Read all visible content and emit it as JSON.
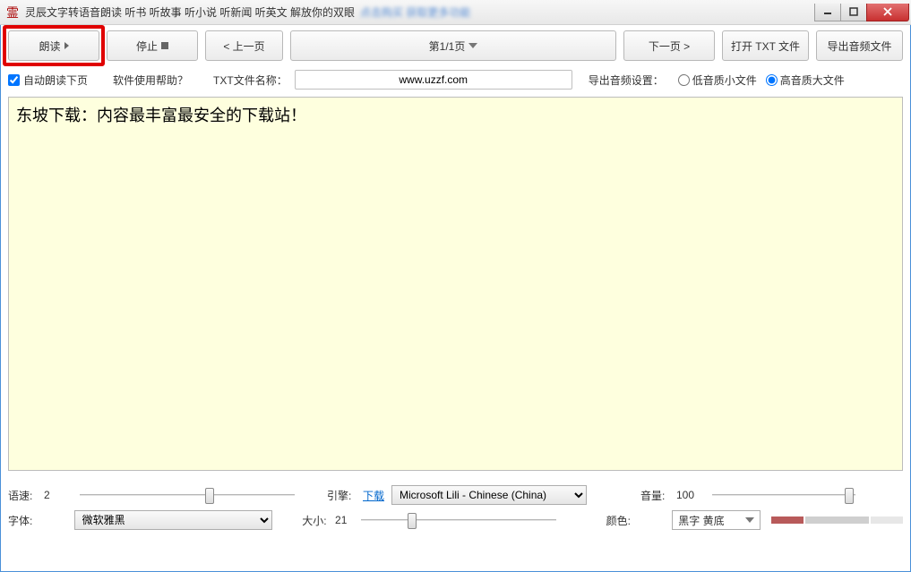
{
  "window": {
    "title": "灵辰文字转语音朗读   听书 听故事 听小说 听新闻 听英文 解放你的双眼",
    "blur_text": "点击购买  获取更多功能"
  },
  "toolbar": {
    "read": "朗读",
    "stop": "停止",
    "prev": "< 上一页",
    "page": "第1/1页",
    "next": "下一页 >",
    "open_txt": "打开 TXT 文件",
    "export_audio": "导出音频文件"
  },
  "row2": {
    "auto_read": "自动朗读下页",
    "help": "软件使用帮助？",
    "txt_name_label": "TXT文件名称：",
    "txt_name_value": "www.uzzf.com",
    "export_settings": "导出音频设置：",
    "low_quality": "低音质小文件",
    "high_quality": "高音质大文件"
  },
  "content": {
    "text": "东坡下载：内容最丰富最安全的下载站！"
  },
  "footer": {
    "speed_label": "语速:",
    "speed_value": "2",
    "engine_label": "引擎:",
    "download": "下载",
    "engine_value": "Microsoft Lili - Chinese (China)",
    "volume_label": "音量:",
    "volume_value": "100",
    "font_label": "字体:",
    "font_value": "微软雅黑",
    "size_label": "大小:",
    "size_value": "21",
    "color_label": "颜色:",
    "color_value": "黑字 黄底"
  }
}
